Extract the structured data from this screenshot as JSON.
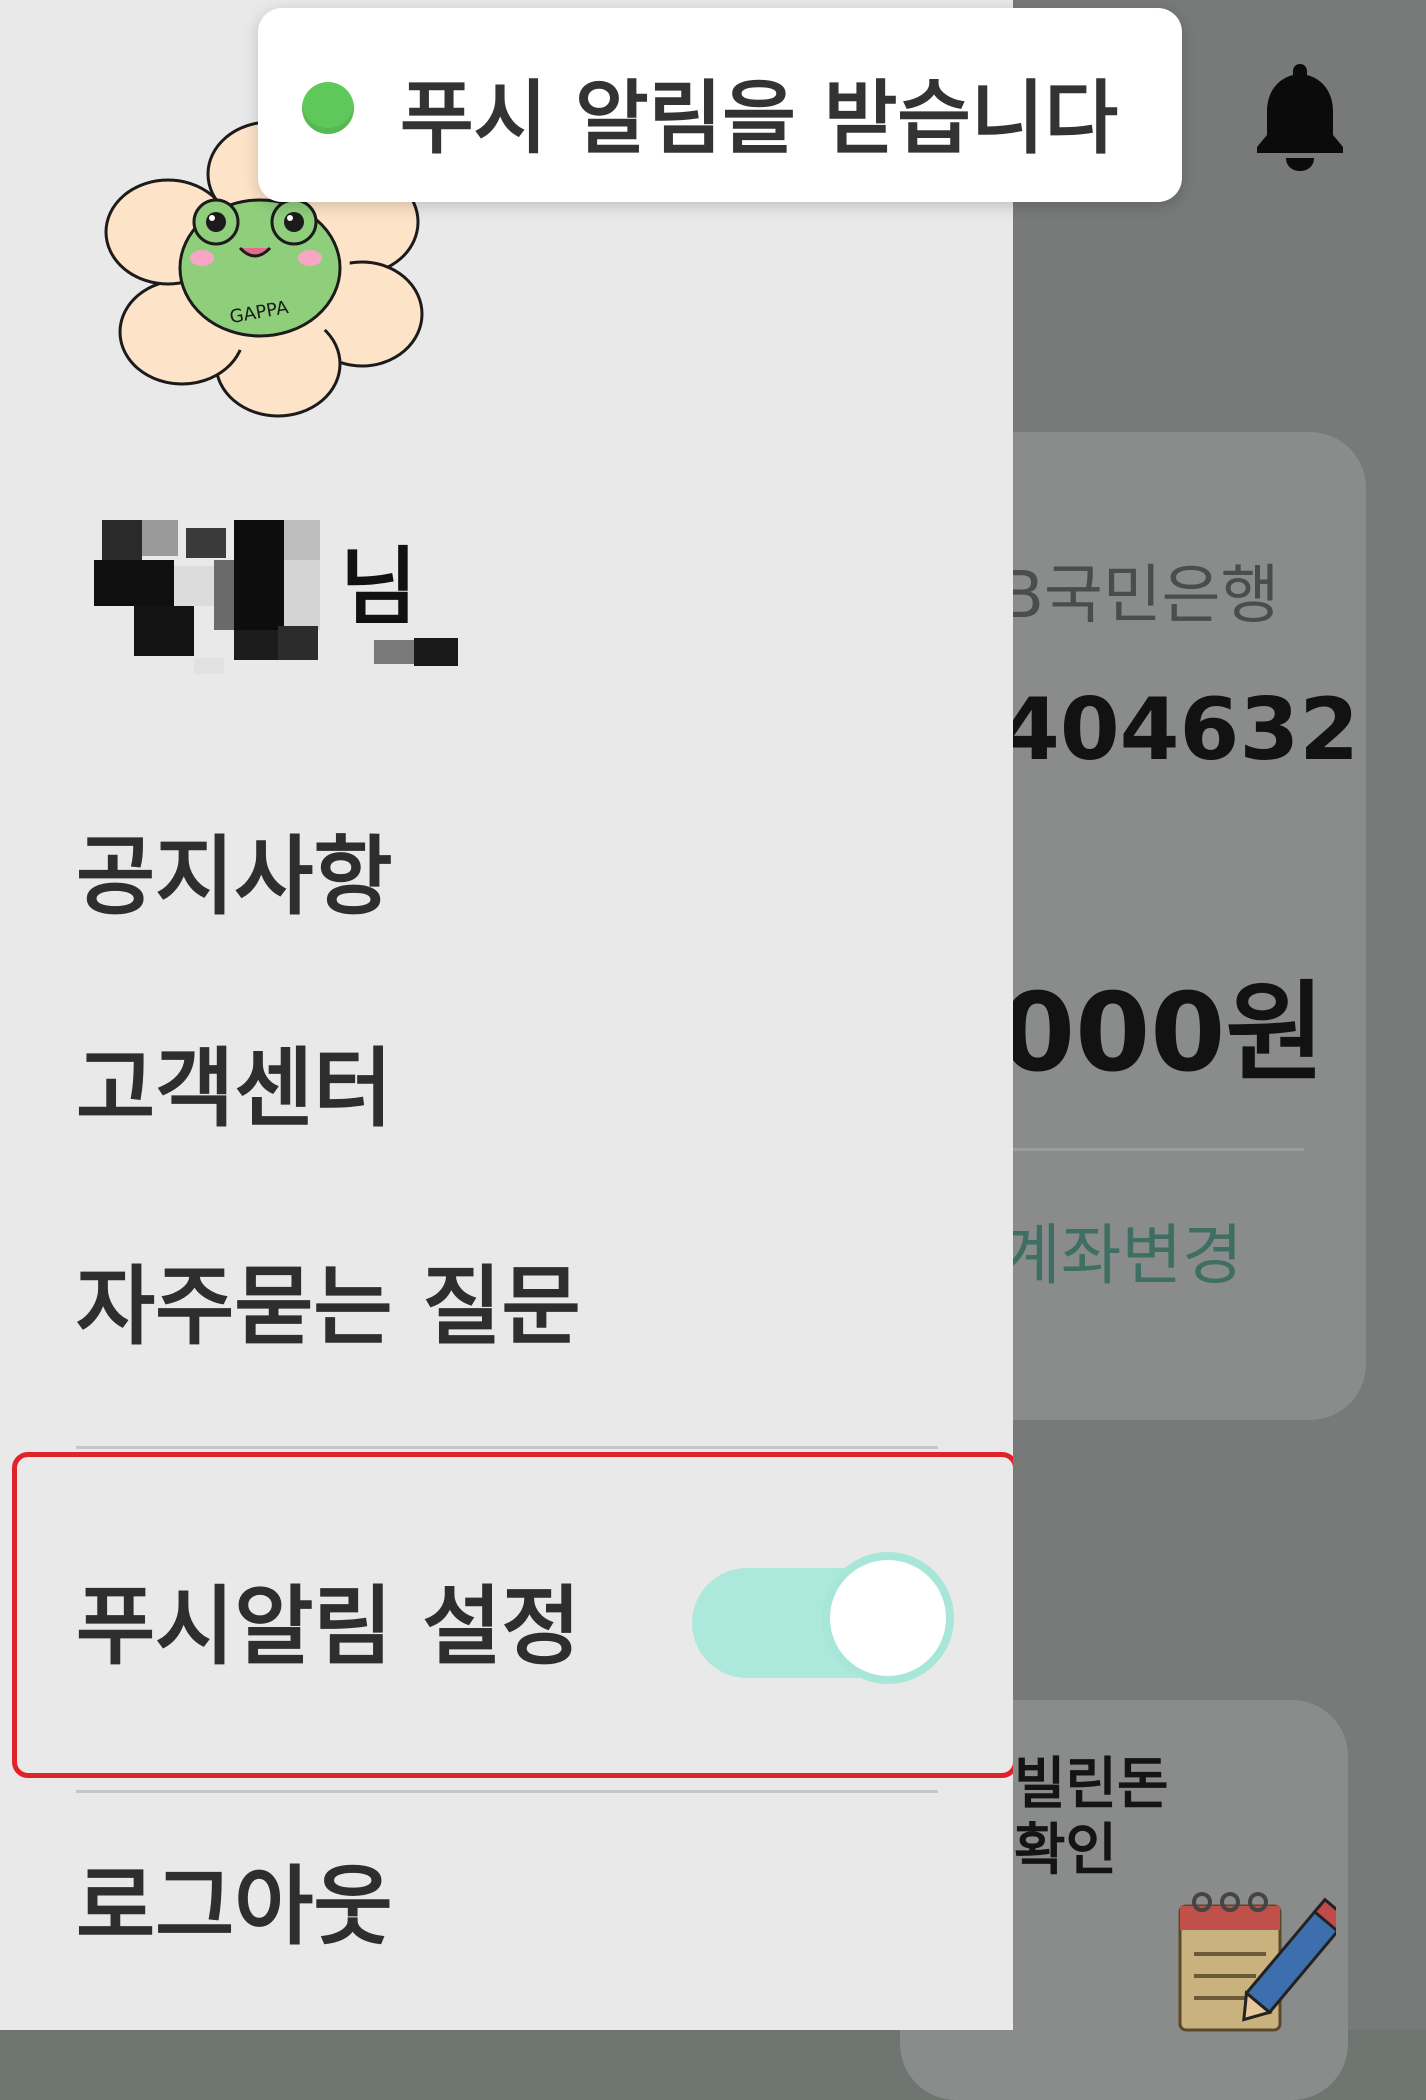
{
  "toast": {
    "message": "푸시 알림을 받습니다",
    "indicator_color": "#5fc85a"
  },
  "background": {
    "bell_icon": "bell-icon",
    "account_card": {
      "bank": "B국민은행",
      "number": "404632",
      "amount": "000원",
      "change_link": "계좌변경"
    },
    "loan_card": {
      "label_line1": "빌린돈",
      "label_line2": "확인",
      "icon": "notepad-pencil-icon"
    }
  },
  "drawer": {
    "profile_image": "frog-flower-avatar",
    "profile_badge_text": "GAPPA",
    "user_name_suffix": "님",
    "menu": {
      "notice": "공지사항",
      "support": "고객센터",
      "faq": "자주묻는 질문",
      "push_setting": "푸시알림 설정",
      "logout": "로그아웃"
    },
    "push_toggle": {
      "state": "on",
      "track_color": "#ade8dc",
      "highlight_color": "#e0222a"
    }
  }
}
